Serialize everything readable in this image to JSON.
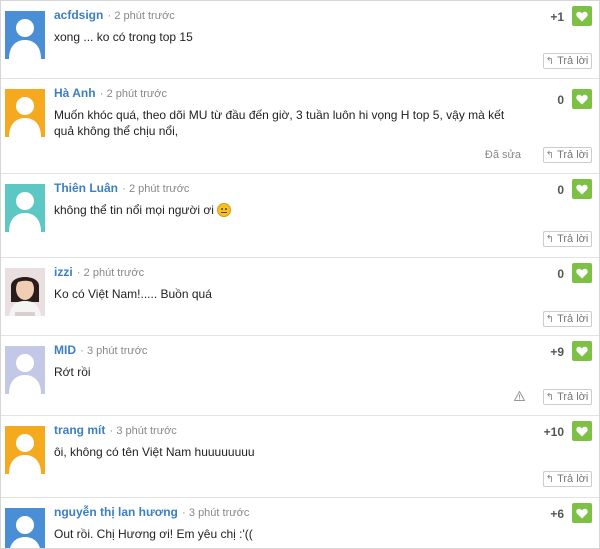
{
  "reply_label": "Trả lời",
  "colors": {
    "author": "#3b7fc4",
    "like": "#7cc144"
  },
  "comments": [
    {
      "author": "acfdsign",
      "time": "2 phút trước",
      "text": "xong ... ko có trong top 15",
      "score": "+1",
      "avatar": "blue"
    },
    {
      "author": "Hà Anh",
      "time": "2 phút trước",
      "text": "Muốn khóc quá, theo dõi MU từ đầu đến giờ, 3 tuần luôn hi vọng H top 5, vậy mà kết quả không thể chịu nổi,",
      "score": "0",
      "edited": "Đã sửa",
      "avatar": "orange"
    },
    {
      "author": "Thiên Luân",
      "time": "2 phút trước",
      "text": "không thể tin nổi mọi người ơi",
      "score": "0",
      "avatar": "teal",
      "emoji": "sad-face-emoji"
    },
    {
      "author": "izzi",
      "time": "2 phút trước",
      "text": "Ko có Việt Nam!..... Buồn quá",
      "score": "0",
      "avatar": "photo"
    },
    {
      "author": "MID",
      "time": "3 phút trước",
      "text": "Rớt rồi",
      "score": "+9",
      "avatar": "lavender",
      "warn_icon": "warning-icon"
    },
    {
      "author": "trang mít",
      "time": "3 phút trước",
      "text": "ôi, không có tên Việt Nam huuuuuuuu",
      "score": "+10",
      "avatar": "orange"
    },
    {
      "author": "nguyễn thị lan hương",
      "time": "3 phút trước",
      "text": "Out rồi. Chị Hương ơi! Em yêu chị :'((",
      "score": "+6",
      "avatar": "blue"
    }
  ]
}
